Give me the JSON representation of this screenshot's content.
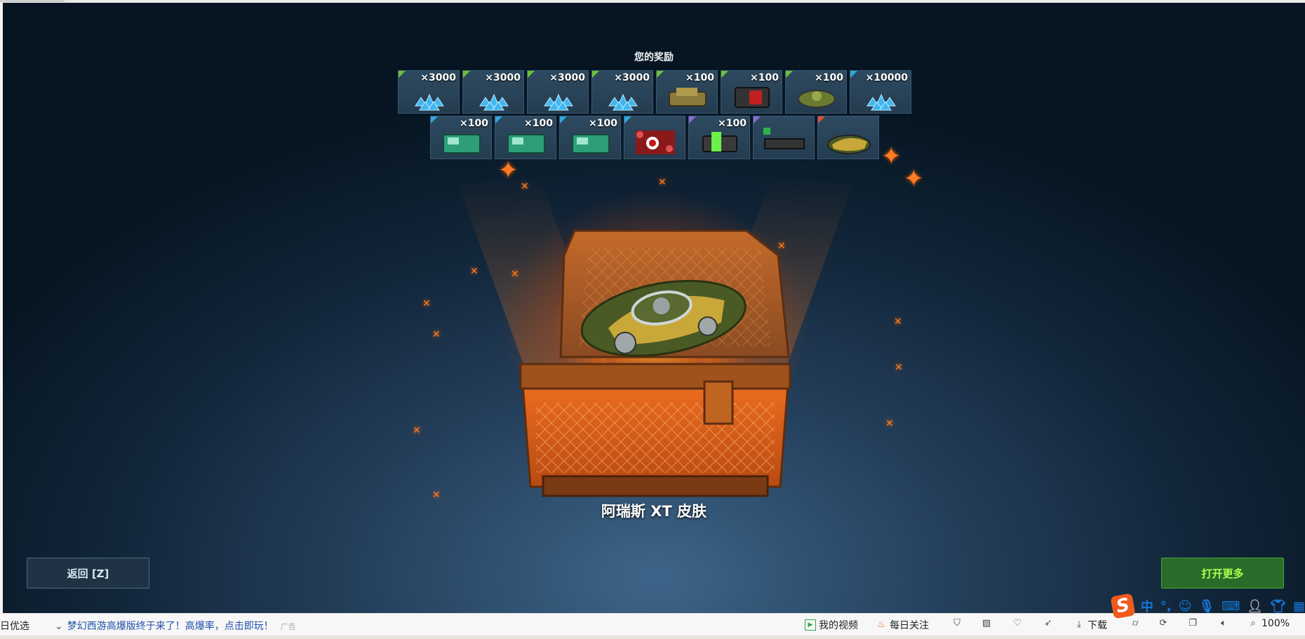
{
  "rewards": {
    "title": "您的奖励",
    "row1": [
      {
        "qty": "×3000",
        "icon": "crystals-icon",
        "color": "#6cbf3c"
      },
      {
        "qty": "×3000",
        "icon": "crystals-icon",
        "color": "#6cbf3c"
      },
      {
        "qty": "×3000",
        "icon": "crystals-icon",
        "color": "#6cbf3c"
      },
      {
        "qty": "×3000",
        "icon": "crystals-icon",
        "color": "#6cbf3c"
      },
      {
        "qty": "×100",
        "icon": "armor-booster-icon",
        "color": "#6cbf3c"
      },
      {
        "qty": "×100",
        "icon": "damage-booster-icon",
        "color": "#6cbf3c"
      },
      {
        "qty": "×100",
        "icon": "mine-icon",
        "color": "#6cbf3c"
      },
      {
        "qty": "×10000",
        "icon": "crystals-icon",
        "color": "#2fa8e0"
      }
    ],
    "row2": [
      {
        "qty": "×100",
        "icon": "speed-booster-icon",
        "color": "#2fa8e0"
      },
      {
        "qty": "×100",
        "icon": "speed-booster-icon",
        "color": "#2fa8e0"
      },
      {
        "qty": "×100",
        "icon": "speed-booster-icon",
        "color": "#2fa8e0"
      },
      {
        "qty": "",
        "icon": "paint-icon",
        "color": "#2fa8e0"
      },
      {
        "qty": "×100",
        "icon": "battery-icon",
        "color": "#8e6cd8"
      },
      {
        "qty": "",
        "icon": "turret-skin-icon",
        "color": "#8e6cd8"
      },
      {
        "qty": "",
        "icon": "hull-skin-icon",
        "color": "#e0503a"
      }
    ]
  },
  "chest": {
    "item_name": "阿瑞斯 XT 皮肤"
  },
  "buttons": {
    "back": "返回 [Z]",
    "open_more": "打开更多"
  },
  "statusbar": {
    "left_text": "日优选",
    "news": "梦幻西游高爆版终于来了！高爆率，点击即玩！",
    "ad_label": "广告",
    "my_videos": "我的视频",
    "daily_follow": "每日关注",
    "download": "下载",
    "zoom": "100%"
  },
  "ime": {
    "mode": "中"
  }
}
